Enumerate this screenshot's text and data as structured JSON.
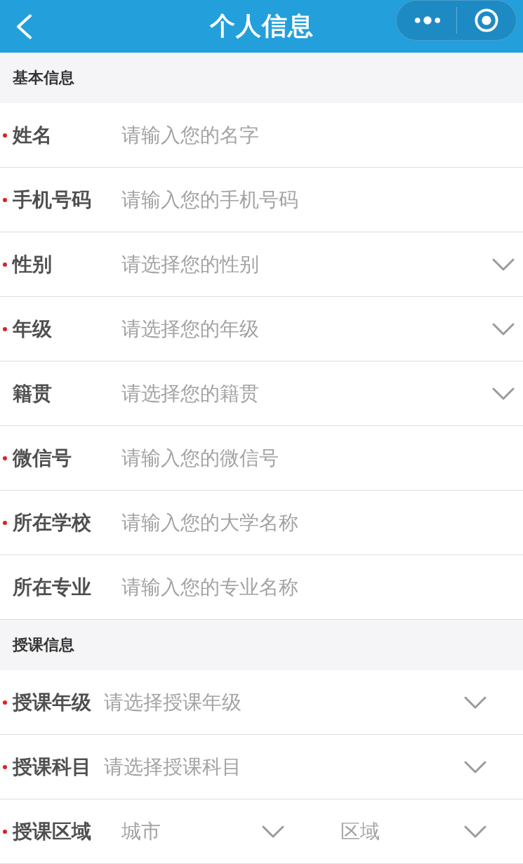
{
  "nav_bar": {
    "title": "个人信息"
  },
  "sections": [
    {
      "title": "基本信息",
      "fields": [
        {
          "kind": "input",
          "label": "姓名",
          "required": true,
          "placeholder": "请输入您的名字"
        },
        {
          "kind": "input",
          "label": "手机号码",
          "required": true,
          "placeholder": "请输入您的手机号码"
        },
        {
          "kind": "select",
          "label": "性别",
          "required": true,
          "placeholder": "请选择您的性别"
        },
        {
          "kind": "select",
          "label": "年级",
          "required": true,
          "placeholder": "请选择您的年级"
        },
        {
          "kind": "select",
          "label": "籍贯",
          "required": false,
          "placeholder": "请选择您的籍贯"
        },
        {
          "kind": "input",
          "label": "微信号",
          "required": true,
          "placeholder": "请输入您的微信号"
        },
        {
          "kind": "input",
          "label": "所在学校",
          "required": true,
          "placeholder": "请输入您的大学名称"
        },
        {
          "kind": "input",
          "label": "所在专业",
          "required": false,
          "placeholder": "请输入您的专业名称"
        }
      ]
    },
    {
      "title": "授课信息",
      "fields": [
        {
          "kind": "select",
          "label": "授课年级",
          "required": true,
          "placeholder": "请选择授课年级"
        },
        {
          "kind": "select",
          "label": "授课科目",
          "required": true,
          "placeholder": "请选择授课科目"
        },
        {
          "kind": "region",
          "label": "授课区域",
          "required": true,
          "selects": [
            {
              "placeholder": "城市"
            },
            {
              "placeholder": "区域"
            }
          ]
        }
      ]
    }
  ]
}
